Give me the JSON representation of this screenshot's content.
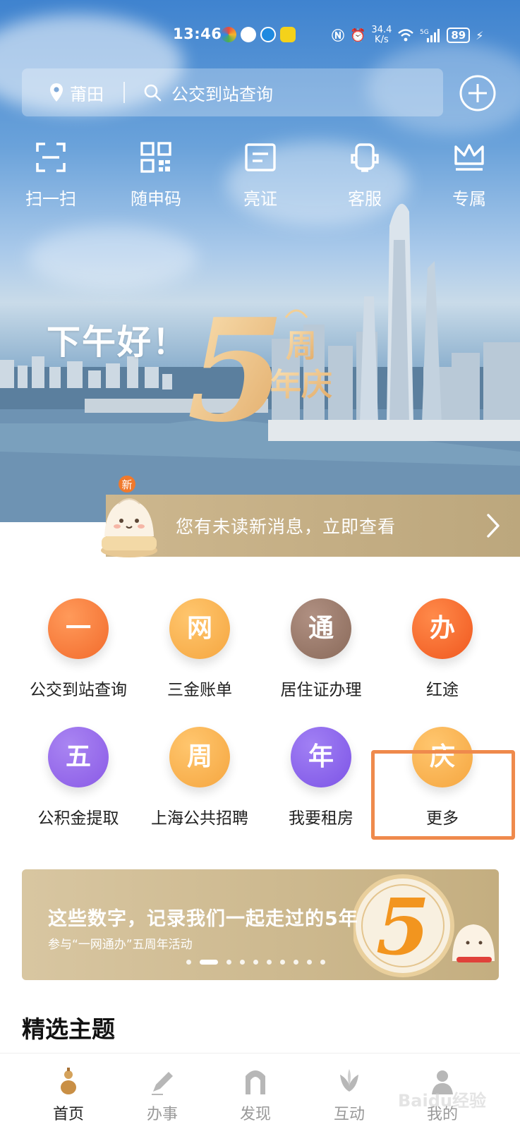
{
  "status_bar": {
    "time": "13:46",
    "network_speed_value": "34.4",
    "network_speed_unit": "K/s",
    "battery": "89",
    "icons": [
      "app-icon",
      "wechat-icon",
      "browser-icon",
      "yy-icon",
      "nfc-icon",
      "alarm-icon",
      "wifi-icon",
      "5g-signal-icon",
      "charging-icon"
    ]
  },
  "header": {
    "city": "莆田",
    "search_placeholder": "公交到站查询",
    "icons": [
      "location-pin-icon",
      "search-icon",
      "plus-circle-icon"
    ]
  },
  "quick_actions": [
    {
      "label": "扫一扫",
      "icon": "scan-icon"
    },
    {
      "label": "随申码",
      "icon": "qr-code-icon"
    },
    {
      "label": "亮证",
      "icon": "id-card-icon"
    },
    {
      "label": "客服",
      "icon": "customer-service-icon"
    },
    {
      "label": "专属",
      "icon": "crown-icon"
    }
  ],
  "hero": {
    "greeting": "下午好！",
    "anniversary_digit": "5",
    "anniversary_line1": "周",
    "anniversary_line2": "年庆"
  },
  "message_banner": {
    "badge": "新",
    "text": "您有未读新消息，立即查看"
  },
  "services": [
    {
      "char": "一",
      "label": "公交到站查询",
      "color": "#f26b2c"
    },
    {
      "char": "网",
      "label": "三金账单",
      "color": "#f5a640"
    },
    {
      "char": "通",
      "label": "居住证办理",
      "color": "#8a6a5a"
    },
    {
      "char": "办",
      "label": "红途",
      "color": "#f0581f"
    },
    {
      "char": "五",
      "label": "公积金提取",
      "color": "#8a5ae6"
    },
    {
      "char": "周",
      "label": "上海公共招聘",
      "color": "#f5a640"
    },
    {
      "char": "年",
      "label": "我要租房",
      "color": "#7d54e6"
    },
    {
      "char": "庆",
      "label": "更多",
      "color": "#f5a640"
    }
  ],
  "promo_banner": {
    "title": "这些数字，记录我们一起走过的5年",
    "subtitle": "参与“一网通办”五周年活动",
    "badge_digit": "5",
    "dot_count": 10,
    "active_dot": 1
  },
  "section_title": "精选主题",
  "tab_bar": [
    {
      "label": "首页",
      "icon": "home-gourd-icon",
      "active": true
    },
    {
      "label": "办事",
      "icon": "pen-icon",
      "active": false
    },
    {
      "label": "发现",
      "icon": "arch-icon",
      "active": false
    },
    {
      "label": "互动",
      "icon": "magnolia-icon",
      "active": false
    },
    {
      "label": "我的",
      "icon": "profile-icon",
      "active": false
    }
  ],
  "watermark": "Baidu经验"
}
